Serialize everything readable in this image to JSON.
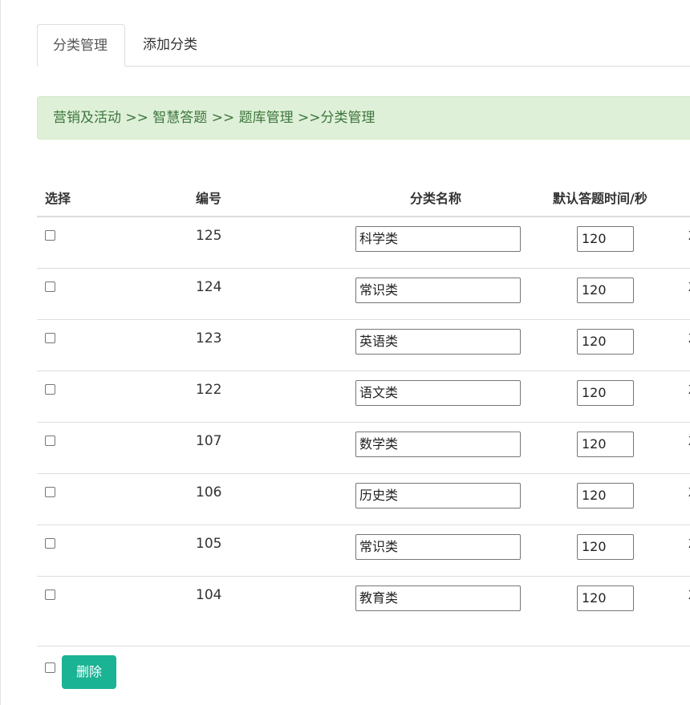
{
  "tabs": [
    {
      "label": "分类管理",
      "active": true
    },
    {
      "label": "添加分类",
      "active": false
    }
  ],
  "breadcrumb": "营销及活动 >> 智慧答题 >> 题库管理 >>分类管理",
  "table": {
    "headers": {
      "select": "选择",
      "id": "编号",
      "name": "分类名称",
      "time": "默认答题时间/秒"
    },
    "rows": [
      {
        "id": "125",
        "name": "科学类",
        "time": "120",
        "cut": "Z"
      },
      {
        "id": "124",
        "name": "常识类",
        "time": "120",
        "cut": "Z"
      },
      {
        "id": "123",
        "name": "英语类",
        "time": "120",
        "cut": "Z"
      },
      {
        "id": "122",
        "name": "语文类",
        "time": "120",
        "cut": "Z"
      },
      {
        "id": "107",
        "name": "数学类",
        "time": "120",
        "cut": "Z"
      },
      {
        "id": "106",
        "name": "历史类",
        "time": "120",
        "cut": "Z"
      },
      {
        "id": "105",
        "name": "常识类",
        "time": "120",
        "cut": "Z"
      },
      {
        "id": "104",
        "name": "教育类",
        "time": "120",
        "cut": "Z"
      }
    ]
  },
  "footer": {
    "delete_label": "删除"
  },
  "colors": {
    "breadcrumb_bg": "#dff0d8",
    "breadcrumb_text": "#3c763d",
    "delete_button": "#1ab394"
  }
}
